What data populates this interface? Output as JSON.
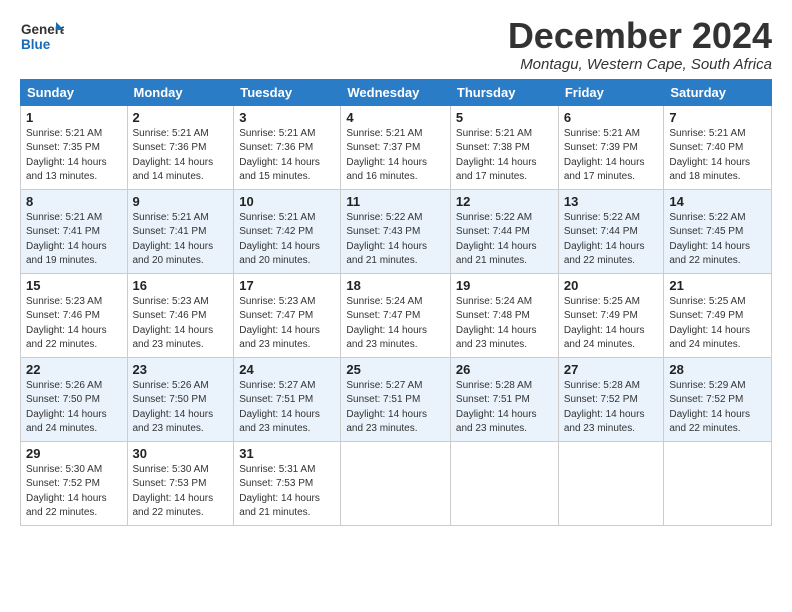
{
  "logo": {
    "text1": "General",
    "text2": "Blue"
  },
  "title": "December 2024",
  "location": "Montagu, Western Cape, South Africa",
  "days_of_week": [
    "Sunday",
    "Monday",
    "Tuesday",
    "Wednesday",
    "Thursday",
    "Friday",
    "Saturday"
  ],
  "weeks": [
    {
      "stripe": false,
      "days": [
        {
          "num": "1",
          "info": "Sunrise: 5:21 AM\nSunset: 7:35 PM\nDaylight: 14 hours\nand 13 minutes."
        },
        {
          "num": "2",
          "info": "Sunrise: 5:21 AM\nSunset: 7:36 PM\nDaylight: 14 hours\nand 14 minutes."
        },
        {
          "num": "3",
          "info": "Sunrise: 5:21 AM\nSunset: 7:36 PM\nDaylight: 14 hours\nand 15 minutes."
        },
        {
          "num": "4",
          "info": "Sunrise: 5:21 AM\nSunset: 7:37 PM\nDaylight: 14 hours\nand 16 minutes."
        },
        {
          "num": "5",
          "info": "Sunrise: 5:21 AM\nSunset: 7:38 PM\nDaylight: 14 hours\nand 17 minutes."
        },
        {
          "num": "6",
          "info": "Sunrise: 5:21 AM\nSunset: 7:39 PM\nDaylight: 14 hours\nand 17 minutes."
        },
        {
          "num": "7",
          "info": "Sunrise: 5:21 AM\nSunset: 7:40 PM\nDaylight: 14 hours\nand 18 minutes."
        }
      ]
    },
    {
      "stripe": true,
      "days": [
        {
          "num": "8",
          "info": "Sunrise: 5:21 AM\nSunset: 7:41 PM\nDaylight: 14 hours\nand 19 minutes."
        },
        {
          "num": "9",
          "info": "Sunrise: 5:21 AM\nSunset: 7:41 PM\nDaylight: 14 hours\nand 20 minutes."
        },
        {
          "num": "10",
          "info": "Sunrise: 5:21 AM\nSunset: 7:42 PM\nDaylight: 14 hours\nand 20 minutes."
        },
        {
          "num": "11",
          "info": "Sunrise: 5:22 AM\nSunset: 7:43 PM\nDaylight: 14 hours\nand 21 minutes."
        },
        {
          "num": "12",
          "info": "Sunrise: 5:22 AM\nSunset: 7:44 PM\nDaylight: 14 hours\nand 21 minutes."
        },
        {
          "num": "13",
          "info": "Sunrise: 5:22 AM\nSunset: 7:44 PM\nDaylight: 14 hours\nand 22 minutes."
        },
        {
          "num": "14",
          "info": "Sunrise: 5:22 AM\nSunset: 7:45 PM\nDaylight: 14 hours\nand 22 minutes."
        }
      ]
    },
    {
      "stripe": false,
      "days": [
        {
          "num": "15",
          "info": "Sunrise: 5:23 AM\nSunset: 7:46 PM\nDaylight: 14 hours\nand 22 minutes."
        },
        {
          "num": "16",
          "info": "Sunrise: 5:23 AM\nSunset: 7:46 PM\nDaylight: 14 hours\nand 23 minutes."
        },
        {
          "num": "17",
          "info": "Sunrise: 5:23 AM\nSunset: 7:47 PM\nDaylight: 14 hours\nand 23 minutes."
        },
        {
          "num": "18",
          "info": "Sunrise: 5:24 AM\nSunset: 7:47 PM\nDaylight: 14 hours\nand 23 minutes."
        },
        {
          "num": "19",
          "info": "Sunrise: 5:24 AM\nSunset: 7:48 PM\nDaylight: 14 hours\nand 23 minutes."
        },
        {
          "num": "20",
          "info": "Sunrise: 5:25 AM\nSunset: 7:49 PM\nDaylight: 14 hours\nand 24 minutes."
        },
        {
          "num": "21",
          "info": "Sunrise: 5:25 AM\nSunset: 7:49 PM\nDaylight: 14 hours\nand 24 minutes."
        }
      ]
    },
    {
      "stripe": true,
      "days": [
        {
          "num": "22",
          "info": "Sunrise: 5:26 AM\nSunset: 7:50 PM\nDaylight: 14 hours\nand 24 minutes."
        },
        {
          "num": "23",
          "info": "Sunrise: 5:26 AM\nSunset: 7:50 PM\nDaylight: 14 hours\nand 23 minutes."
        },
        {
          "num": "24",
          "info": "Sunrise: 5:27 AM\nSunset: 7:51 PM\nDaylight: 14 hours\nand 23 minutes."
        },
        {
          "num": "25",
          "info": "Sunrise: 5:27 AM\nSunset: 7:51 PM\nDaylight: 14 hours\nand 23 minutes."
        },
        {
          "num": "26",
          "info": "Sunrise: 5:28 AM\nSunset: 7:51 PM\nDaylight: 14 hours\nand 23 minutes."
        },
        {
          "num": "27",
          "info": "Sunrise: 5:28 AM\nSunset: 7:52 PM\nDaylight: 14 hours\nand 23 minutes."
        },
        {
          "num": "28",
          "info": "Sunrise: 5:29 AM\nSunset: 7:52 PM\nDaylight: 14 hours\nand 22 minutes."
        }
      ]
    },
    {
      "stripe": false,
      "days": [
        {
          "num": "29",
          "info": "Sunrise: 5:30 AM\nSunset: 7:52 PM\nDaylight: 14 hours\nand 22 minutes."
        },
        {
          "num": "30",
          "info": "Sunrise: 5:30 AM\nSunset: 7:53 PM\nDaylight: 14 hours\nand 22 minutes."
        },
        {
          "num": "31",
          "info": "Sunrise: 5:31 AM\nSunset: 7:53 PM\nDaylight: 14 hours\nand 21 minutes."
        },
        {
          "num": "",
          "info": ""
        },
        {
          "num": "",
          "info": ""
        },
        {
          "num": "",
          "info": ""
        },
        {
          "num": "",
          "info": ""
        }
      ]
    }
  ]
}
